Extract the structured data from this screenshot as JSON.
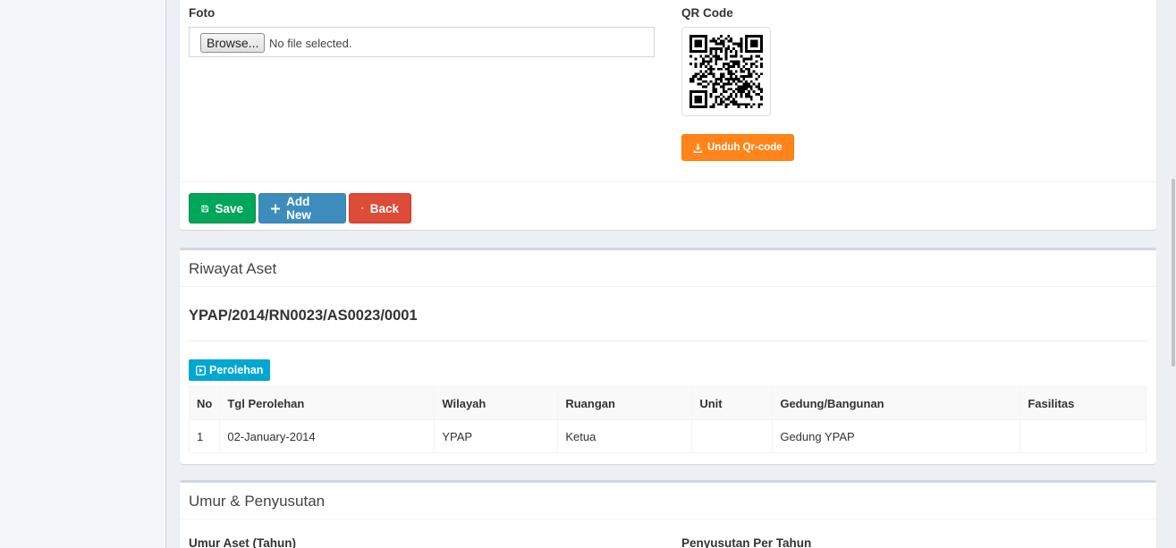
{
  "form": {
    "foto_label": "Foto",
    "browse_label": "Browse...",
    "file_status": "No file selected.",
    "qr_label": "QR Code",
    "download_qr_label": "Unduh Qr-code"
  },
  "actions": {
    "save_label": "Save",
    "add_new_label": "Add New",
    "back_label": "Back"
  },
  "history": {
    "title": "Riwayat Aset",
    "asset_code": "YPAP/2014/RN0023/AS0023/0001",
    "section_badge": "Perolehan",
    "columns": [
      "No",
      "Tgl Perolehan",
      "Wilayah",
      "Ruangan",
      "Unit",
      "Gedung/Bangunan",
      "Fasilitas"
    ],
    "rows": [
      [
        "1",
        "02-January-2014",
        "YPAP",
        "Ketua",
        "",
        "Gedung YPAP",
        ""
      ]
    ]
  },
  "depreciation": {
    "title": "Umur & Penyusutan",
    "age_label": "Umur Aset (Tahun)",
    "per_year_label": "Penyusutan Per Tahun"
  },
  "colors": {
    "save": "#00a65a",
    "add_new": "#3c8dbc",
    "back": "#dd4b39",
    "download": "#ff851b",
    "badge": "#00a7d0"
  }
}
